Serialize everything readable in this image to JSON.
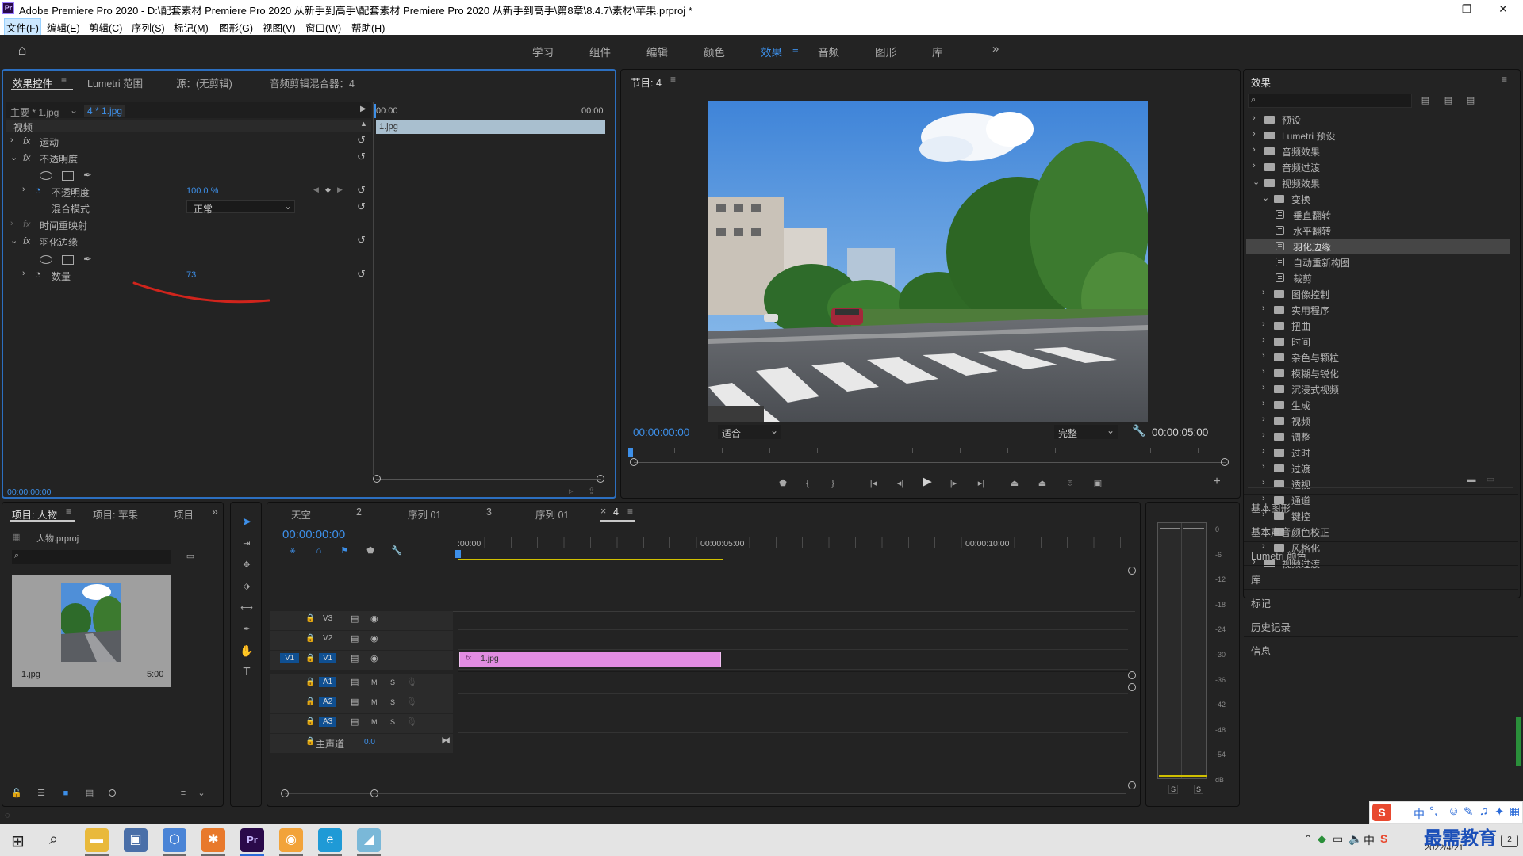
{
  "titlebar": {
    "app_logo": "Pr",
    "title": "Adobe Premiere Pro 2020 - D:\\配套素材 Premiere Pro 2020 从新手到高手\\配套素材 Premiere Pro 2020 从新手到高手\\第8章\\8.4.7\\素材\\苹果.prproj *"
  },
  "menu": [
    "文件(F)",
    "编辑(E)",
    "剪辑(C)",
    "序列(S)",
    "标记(M)",
    "图形(G)",
    "视图(V)",
    "窗口(W)",
    "帮助(H)"
  ],
  "workspaces": [
    "学习",
    "组件",
    "编辑",
    "颜色",
    "效果",
    "音频",
    "图形",
    "库"
  ],
  "workspace_more": "»",
  "effect_controls": {
    "tabs": [
      "效果控件",
      "Lumetri 范围",
      "源：(无剪辑)",
      "音频剪辑混合器：4"
    ],
    "master": "主要 * 1.jpg",
    "clip": "4 * 1.jpg",
    "time_start": "00:00",
    "time_end": "00:00",
    "section_video": "视频",
    "rows": {
      "motion": "运动",
      "opacity": "不透明度",
      "opacity_prop": "不透明度",
      "opacity_val": "100.0 %",
      "blend": "混合模式",
      "blend_val": "正常",
      "time_remap": "时间重映射",
      "feather": "羽化边缘",
      "amount": "数量",
      "amount_val": "73"
    },
    "fx": "fx",
    "clip_bar": "1.jpg",
    "timecode": "00:00:00:00"
  },
  "program": {
    "tab": "节目: 4",
    "timecode": "00:00:00:00",
    "fit": "适合",
    "quality": "完整",
    "duration": "00:00:05:00"
  },
  "effects": {
    "title": "效果",
    "tree": [
      "预设",
      "Lumetri 预设",
      "音频效果",
      "音频过渡",
      "视频效果",
      "变换",
      "垂直翻转",
      "水平翻转",
      "羽化边缘",
      "自动重新构图",
      "裁剪",
      "图像控制",
      "实用程序",
      "扭曲",
      "时间",
      "杂色与颗粒",
      "模糊与锐化",
      "沉浸式视频",
      "生成",
      "视频",
      "调整",
      "过时",
      "过渡",
      "透视",
      "通道",
      "键控",
      "颜色校正",
      "风格化",
      "视频过渡"
    ],
    "selected": "羽化边缘",
    "panels": [
      "基本图形",
      "基本声音",
      "Lumetri 颜色",
      "库",
      "标记",
      "历史记录",
      "信息"
    ]
  },
  "project": {
    "tabs": [
      "项目: 人物",
      "项目: 苹果",
      "项目"
    ],
    "more": "»",
    "file": "人物.prproj",
    "item_name": "1.jpg",
    "item_dur": "5:00"
  },
  "timeline": {
    "tabs": [
      "天空",
      "2",
      "序列 01",
      "3",
      "序列 01",
      "4"
    ],
    "timecode": "00:00:00:00",
    "ruler": [
      ":00:00",
      "00:00:05:00",
      "00:00:10:00"
    ],
    "video_tracks": [
      "V3",
      "V2",
      "V1"
    ],
    "audio_tracks": [
      "A1",
      "A2",
      "A3"
    ],
    "src_v": "V1",
    "master": "主声道",
    "master_val": "0.0",
    "clip": "1.jpg",
    "m": "M",
    "s": "S"
  },
  "meter": {
    "scale": [
      "0",
      "-6",
      "-12",
      "-18",
      "-24",
      "-30",
      "-36",
      "-42",
      "-48",
      "-54",
      "dB"
    ],
    "s": [
      "S",
      "S"
    ]
  },
  "taskbar": {
    "ime": "中",
    "date": "2022/4/21",
    "watermark": "最需教育"
  },
  "colors": {
    "accent": "#3d8fe8",
    "clip_pink": "#e18ce1",
    "panel_bg": "#232323"
  }
}
